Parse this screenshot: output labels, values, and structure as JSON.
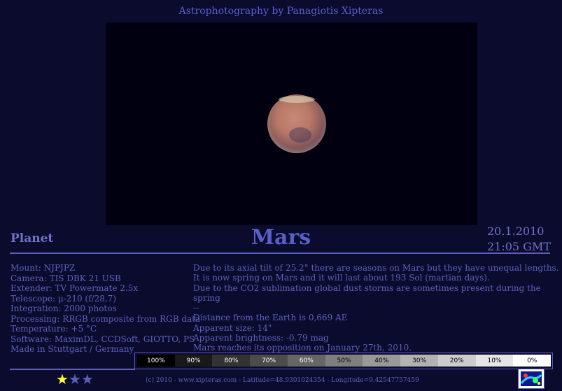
{
  "header": {
    "title": "Astrophotography by Panagiotis Xipteras"
  },
  "planet_label": "Planet",
  "title": "Mars",
  "date": "20.1.2010",
  "time": "21:05 GMT",
  "details": [
    "Mount: NJPJPZ",
    "Camera: TIS DBK 21 USB",
    "Extender: TV Powermate 2.5x",
    "Telescope: μ-210 (f/28,7)",
    "Integration: 2000 photos",
    "Processing: RRGB composite from RGB data",
    "Temperature: +5 °C",
    "Software: MaximDL, CCDSoft, GIOTTO, PS",
    "Made in Stuttgart / Germany"
  ],
  "description": [
    "Due to its axial tilt of 25.2° there are seasons on Mars but they have unequal lengths.",
    "It is now spring on Mars and it will last about 193 Sol (martian days).",
    "Due to the CO2 sublimation global dust storms are sometimes present during the spring",
    "--",
    "Distance from the Earth is 0,669 AE",
    "Apparent size: 14\"",
    "Apparent brightness: -0.79 mag",
    "Mars reaches its opposition on January 27th, 2010."
  ],
  "scale": [
    {
      "label": "100%",
      "bg": "#000000",
      "fg": "#ffffff"
    },
    {
      "label": "90%",
      "bg": "#191919",
      "fg": "#ffffff"
    },
    {
      "label": "80%",
      "bg": "#333333",
      "fg": "#ffffff"
    },
    {
      "label": "70%",
      "bg": "#4c4c4c",
      "fg": "#ffffff"
    },
    {
      "label": "60%",
      "bg": "#666666",
      "fg": "#ffffff"
    },
    {
      "label": "50%",
      "bg": "#7f7f7f",
      "fg": "#000000"
    },
    {
      "label": "40%",
      "bg": "#999999",
      "fg": "#000000"
    },
    {
      "label": "30%",
      "bg": "#b2b2b2",
      "fg": "#000000"
    },
    {
      "label": "20%",
      "bg": "#cccccc",
      "fg": "#000000"
    },
    {
      "label": "10%",
      "bg": "#e5e5e5",
      "fg": "#000000"
    },
    {
      "label": "0%",
      "bg": "#ffffff",
      "fg": "#000000"
    }
  ],
  "rating": {
    "filled": 1,
    "total": 3,
    "filled_color": "#ffff33",
    "empty_color": "#5b5fb8"
  },
  "footer": "(c) 2010 - www.xipteras.com - Latitude=48.9301024354 - Longitude=9.42547757459",
  "colors": {
    "background": "#0b0b2e",
    "text": "#5d61bd",
    "rule": "#5b5fb8"
  }
}
